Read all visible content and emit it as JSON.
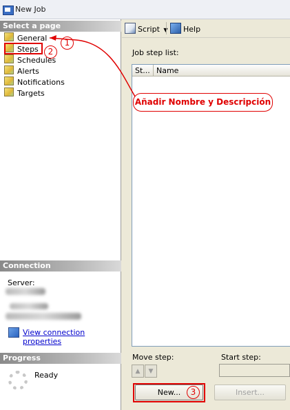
{
  "window": {
    "title": "New Job"
  },
  "left": {
    "select_page_header": "Select a page",
    "pages": [
      {
        "label": "General"
      },
      {
        "label": "Steps"
      },
      {
        "label": "Schedules"
      },
      {
        "label": "Alerts"
      },
      {
        "label": "Notifications"
      },
      {
        "label": "Targets"
      }
    ],
    "connection_header": "Connection",
    "server_label": "Server:",
    "view_connection_link": "View connection properties",
    "progress_header": "Progress",
    "progress_status": "Ready"
  },
  "toolbar": {
    "script_label": "Script",
    "help_label": "Help"
  },
  "steps": {
    "list_label": "Job step list:",
    "columns": [
      "St...",
      "Name"
    ],
    "move_step_label": "Move step:",
    "start_step_label": "Start step:",
    "new_button": "New...",
    "insert_button": "Insert..."
  },
  "annotations": {
    "marker_1": "1",
    "marker_2": "2",
    "marker_3": "3",
    "callout_text": "Añadir Nombre y Descripción",
    "color": "#e00000"
  },
  "icons": [
    "app-icon",
    "page-icon",
    "script-icon",
    "help-icon",
    "connection-properties-icon",
    "progress-spinner-icon",
    "arrow-up-icon",
    "arrow-down-icon"
  ]
}
